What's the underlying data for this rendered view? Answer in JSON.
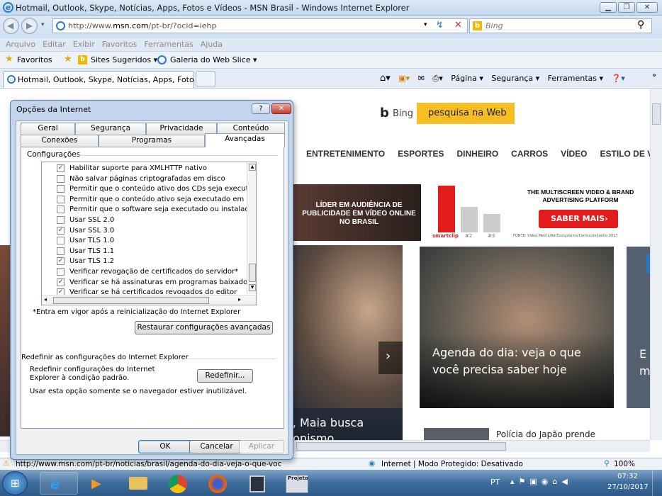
{
  "window": {
    "title": "Hotmail, Outlook, Skype, Notícias, Apps, Fotos e Vídeos - MSN Brasil - Windows Internet Explorer"
  },
  "address": {
    "url_prefix": "http://www.",
    "url_domain": "msn.com",
    "url_rest": "/pt-br/?ocid=iehp",
    "search_placeholder": "Bing"
  },
  "menu": [
    "Arquivo",
    "Editar",
    "Exibir",
    "Favoritos",
    "Ferramentas",
    "Ajuda"
  ],
  "favorites": {
    "label": "Favoritos",
    "items": [
      "Sites Sugeridos ▾",
      "Galeria do Web Slice ▾"
    ]
  },
  "tab": {
    "title": "Hotmail, Outlook, Skype, Notícias, Apps, Fotos e ..."
  },
  "commandbar": [
    "Página ▾",
    "Segurança ▾",
    "Ferramentas ▾"
  ],
  "msn": {
    "bing_label": "Bing",
    "search_button": "pesquisa na Web",
    "nav": [
      "ENTRETENIMENTO",
      "ESPORTES",
      "DINHEIRO",
      "CARROS",
      "VÍDEO",
      "ESTILO DE VIDA"
    ],
    "ad": {
      "left_text": "LÍDER EM AUDIÊNCIA DE PUBLICIDADE EM VÍDEO ONLINE NO BRASIL",
      "right_title": "THE MULTISCREEN VIDEO & BRAND ADVERTISING PLATFORM",
      "cta": "SABER MAIS›",
      "brand": "smartclip",
      "bar2": "#2",
      "bar3": "#3",
      "source": "FONTE: Vídeo Metrix/Ad Ecosystems/Comscore/Junho 2017"
    },
    "story1": "a, Maia busca gonismo",
    "story2": "Agenda do dia: veja o que você precisa saber hoje",
    "story3": "Polícia do Japão prende",
    "partial": "E m"
  },
  "status": {
    "url": "http://www.msn.com/pt-br/noticias/brasil/agenda-do-dia-veja-o-que-voc",
    "zone": "Internet | Modo Protegido: Desativado",
    "zoom": "100%"
  },
  "taskbar": {
    "lang": "PT",
    "time": "07:32",
    "date": "27/10/2017",
    "projeto": "Projeto"
  },
  "dialog": {
    "title": "Opções da Internet",
    "tabs_top": [
      "Geral",
      "Segurança",
      "Privacidade",
      "Conteúdo"
    ],
    "tabs_bottom": [
      "Conexões",
      "Programas",
      "Avançadas"
    ],
    "group1": "Configurações",
    "options": [
      {
        "label": "Habilitar suporte para XMLHTTP nativo",
        "checked": true
      },
      {
        "label": "Não salvar páginas criptografadas em disco",
        "checked": false
      },
      {
        "label": "Permitir que o conteúdo ativo dos CDs seja executado no",
        "checked": false
      },
      {
        "label": "Permitir que o conteúdo ativo seja executado em arquivos",
        "checked": false
      },
      {
        "label": "Permitir que o software seja executado ou instalado mesm",
        "checked": false
      },
      {
        "label": "Usar SSL 2.0",
        "checked": false
      },
      {
        "label": "Usar SSL 3.0",
        "checked": true
      },
      {
        "label": "Usar TLS 1.0",
        "checked": false
      },
      {
        "label": "Usar TLS 1.1",
        "checked": false
      },
      {
        "label": "Usar TLS 1.2",
        "checked": true
      },
      {
        "label": "Verificar revogação de certificados do servidor*",
        "checked": false
      },
      {
        "label": "Verificar se há assinaturas em programas baixados",
        "checked": true
      },
      {
        "label": "Verificar se há certificados revogados do editor",
        "checked": true
      }
    ],
    "note": "*Entra em vigor após a reinicialização do Internet Explorer",
    "restore_button": "Restaurar configurações avançadas",
    "group2": "Redefinir as configurações do Internet Explorer",
    "reset_text": "Redefinir configurações do Internet Explorer à condição padrão.",
    "reset_button": "Redefinir...",
    "reset_note": "Usar esta opção somente se o navegador estiver inutilizável.",
    "ok": "OK",
    "cancel": "Cancelar",
    "apply": "Aplicar"
  }
}
